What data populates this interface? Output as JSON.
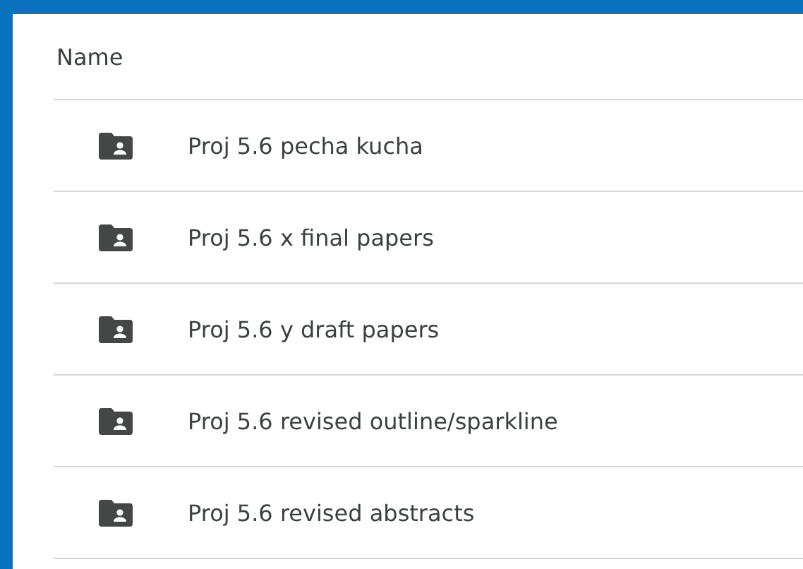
{
  "header": {
    "label": "Name"
  },
  "folders": [
    {
      "name": "Proj 5.6 pecha kucha"
    },
    {
      "name": "Proj 5.6 x final papers"
    },
    {
      "name": "Proj 5.6 y draft papers"
    },
    {
      "name": "Proj 5.6 revised outline/sparkline"
    },
    {
      "name": "Proj 5.6 revised abstracts"
    }
  ]
}
